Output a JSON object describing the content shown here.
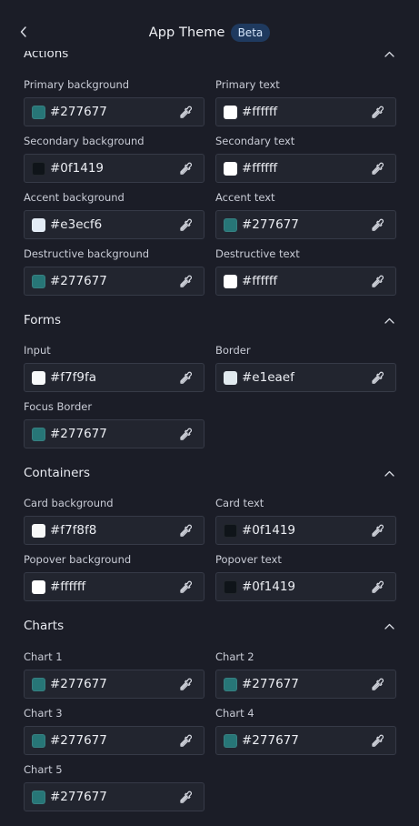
{
  "header": {
    "title": "App Theme",
    "badge": "Beta"
  },
  "sections": {
    "actions": {
      "title": "Actions",
      "fields": [
        {
          "label": "Primary background",
          "value": "#277677",
          "color": "#277677"
        },
        {
          "label": "Primary text",
          "value": "#ffffff",
          "color": "#ffffff"
        },
        {
          "label": "Secondary background",
          "value": "#0f1419",
          "color": "#0f1419"
        },
        {
          "label": "Secondary text",
          "value": "#ffffff",
          "color": "#ffffff"
        },
        {
          "label": "Accent background",
          "value": "#e3ecf6",
          "color": "#e3ecf6"
        },
        {
          "label": "Accent text",
          "value": "#277677",
          "color": "#277677"
        },
        {
          "label": "Destructive background",
          "value": "#277677",
          "color": "#277677"
        },
        {
          "label": "Destructive text",
          "value": "#ffffff",
          "color": "#ffffff"
        }
      ]
    },
    "forms": {
      "title": "Forms",
      "fields": [
        {
          "label": "Input",
          "value": "#f7f9fa",
          "color": "#f7f9fa"
        },
        {
          "label": "Border",
          "value": "#e1eaef",
          "color": "#e1eaef"
        },
        {
          "label": "Focus Border",
          "value": "#277677",
          "color": "#277677"
        }
      ]
    },
    "containers": {
      "title": "Containers",
      "fields": [
        {
          "label": "Card background",
          "value": "#f7f8f8",
          "color": "#f7f8f8"
        },
        {
          "label": "Card text",
          "value": "#0f1419",
          "color": "#0f1419"
        },
        {
          "label": "Popover background",
          "value": "#ffffff",
          "color": "#ffffff"
        },
        {
          "label": "Popover text",
          "value": "#0f1419",
          "color": "#0f1419"
        }
      ]
    },
    "charts": {
      "title": "Charts",
      "fields": [
        {
          "label": "Chart 1",
          "value": "#277677",
          "color": "#277677"
        },
        {
          "label": "Chart 2",
          "value": "#277677",
          "color": "#277677"
        },
        {
          "label": "Chart 3",
          "value": "#277677",
          "color": "#277677"
        },
        {
          "label": "Chart 4",
          "value": "#277677",
          "color": "#277677"
        },
        {
          "label": "Chart 5",
          "value": "#277677",
          "color": "#277677"
        }
      ]
    }
  },
  "icons": {
    "back": "chevron-left-icon",
    "collapse": "chevron-up-icon",
    "picker": "eyedropper-icon"
  }
}
